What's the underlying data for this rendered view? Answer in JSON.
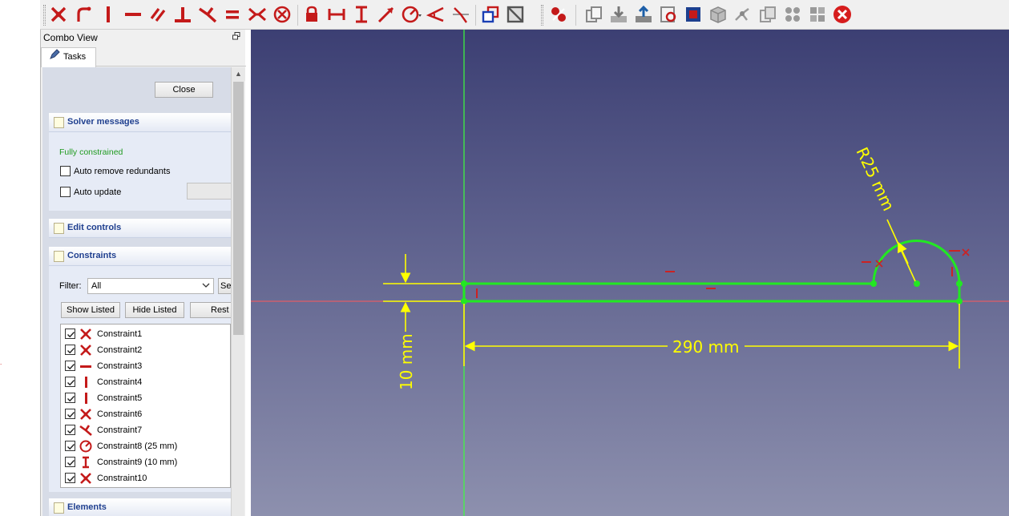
{
  "toolbar": {
    "tools": [
      {
        "name": "point-on-object-constraint-icon"
      },
      {
        "name": "tangent-constraint-icon"
      },
      {
        "name": "vertical-constraint-icon"
      },
      {
        "name": "horizontal-constraint-icon"
      },
      {
        "name": "parallel-constraint-icon"
      },
      {
        "name": "perpendicular-constraint-icon"
      },
      {
        "name": "tangent-curve-constraint-icon"
      },
      {
        "name": "equal-constraint-icon"
      },
      {
        "name": "symmetric-constraint-icon"
      },
      {
        "name": "block-constraint-icon"
      },
      {
        "name": "lock-constraint-icon"
      },
      {
        "name": "horizontal-distance-icon"
      },
      {
        "name": "vertical-distance-icon"
      },
      {
        "name": "distance-constraint-icon"
      },
      {
        "name": "radius-constraint-icon"
      },
      {
        "name": "angle-constraint-icon"
      },
      {
        "name": "snell-law-icon"
      },
      {
        "name": "toggle-construction-icon"
      },
      {
        "name": "toggle-driving-icon"
      },
      {
        "name": "validate-sketch-icon"
      },
      {
        "name": "copy-icon"
      },
      {
        "name": "import-icon"
      },
      {
        "name": "export-icon"
      },
      {
        "name": "view-section-icon"
      },
      {
        "name": "select-faces-icon"
      },
      {
        "name": "box-view-icon"
      },
      {
        "name": "select-conflicts-icon"
      },
      {
        "name": "clone-icon"
      },
      {
        "name": "rectangular-array-icon"
      },
      {
        "name": "remove-axes-icon"
      },
      {
        "name": "delete-all-constraints-icon"
      }
    ]
  },
  "gutter": {
    "mark": "."
  },
  "combo": {
    "title": "Combo View",
    "tab": "Tasks",
    "close_label": "Close",
    "solver": {
      "title": "Solver messages",
      "status": "Fully constrained",
      "auto_remove_label": "Auto remove redundants",
      "auto_update_label": "Auto update"
    },
    "edit_controls_title": "Edit controls",
    "constraints": {
      "title": "Constraints",
      "filter_label": "Filter:",
      "filter_value": "All",
      "select_btn": "Se",
      "show_listed": "Show Listed",
      "hide_listed": "Hide Listed",
      "restore": "Rest",
      "items": [
        {
          "label": "Constraint1",
          "icon": "coincident-icon",
          "checked": true
        },
        {
          "label": "Constraint2",
          "icon": "coincident-icon",
          "checked": true
        },
        {
          "label": "Constraint3",
          "icon": "horizontal-icon",
          "checked": true
        },
        {
          "label": "Constraint4",
          "icon": "vertical-icon",
          "checked": true
        },
        {
          "label": "Constraint5",
          "icon": "vertical-icon",
          "checked": true
        },
        {
          "label": "Constraint6",
          "icon": "coincident-icon",
          "checked": true
        },
        {
          "label": "Constraint7",
          "icon": "tangent-icon",
          "checked": true
        },
        {
          "label": "Constraint8 (25 mm)",
          "icon": "radius-icon",
          "checked": true
        },
        {
          "label": "Constraint9 (10 mm)",
          "icon": "vertical-distance-icon",
          "checked": true
        },
        {
          "label": "Constraint10",
          "icon": "coincident-icon",
          "checked": true
        }
      ]
    },
    "elements_title": "Elements"
  },
  "viewport": {
    "dim_radius": "R25 mm",
    "dim_width": "290 mm",
    "dim_height": "10 mm",
    "colors": {
      "geometry": "#00ff00",
      "dimension": "#ffff00",
      "axis": "#ff4a4a",
      "constraint": "#cc2222"
    }
  }
}
